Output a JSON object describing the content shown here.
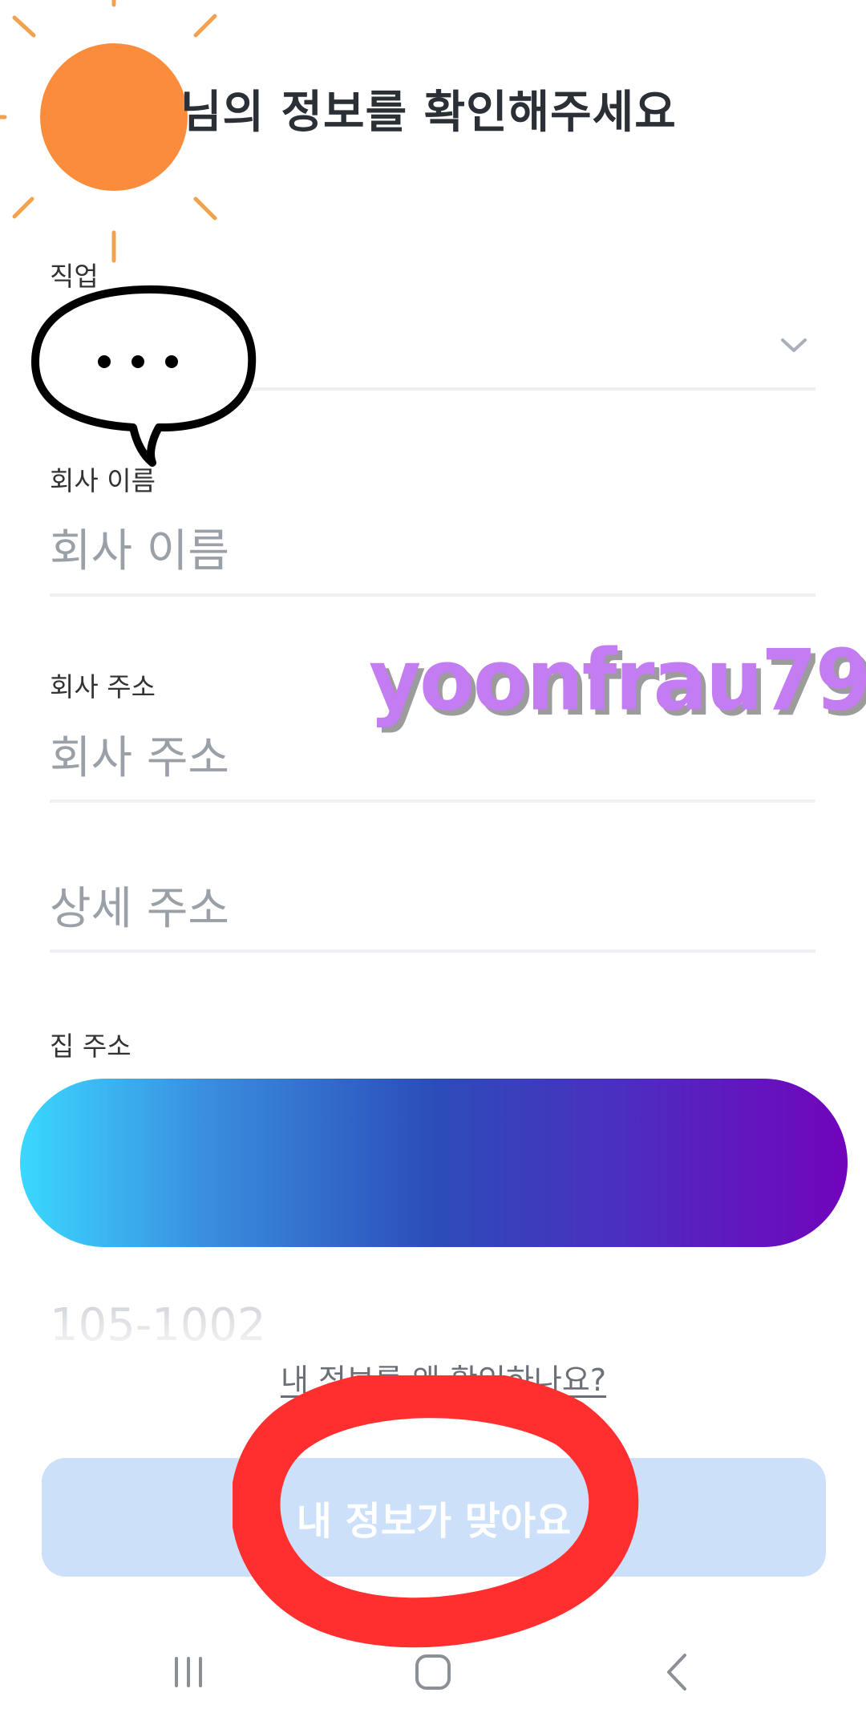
{
  "page": {
    "title": "님의 정보를 확인해주세요"
  },
  "fields": {
    "job": {
      "label": "직업",
      "value": ""
    },
    "company_name": {
      "label": "회사 이름",
      "placeholder": "회사 이름"
    },
    "company_address": {
      "label": "회사 주소",
      "placeholder": "회사 주소"
    },
    "detail_address": {
      "placeholder": "상세 주소"
    },
    "home_address": {
      "label": "집 주소",
      "detail_value": "105-1002"
    }
  },
  "watermark": {
    "text": "yoonfrau79"
  },
  "why_link": {
    "label": "내 정보를 왜 확인하나요?"
  },
  "confirm_button": {
    "label": "내 정보가 맞아요"
  },
  "colors": {
    "title": "#2b2f36",
    "placeholder": "#9aa0a8",
    "button_bg": "#cde0fa",
    "sun": "#fb8c3c",
    "scribble_red": "#ff2f2f",
    "watermark": "#c47cf2"
  },
  "icons": {
    "sun": "sun-sticker-icon",
    "speech_bubble": "speech-bubble-sticker-icon",
    "chevron": "chevron-down-icon",
    "nav_recents": "recents-icon",
    "nav_home": "home-icon",
    "nav_back": "back-icon"
  }
}
